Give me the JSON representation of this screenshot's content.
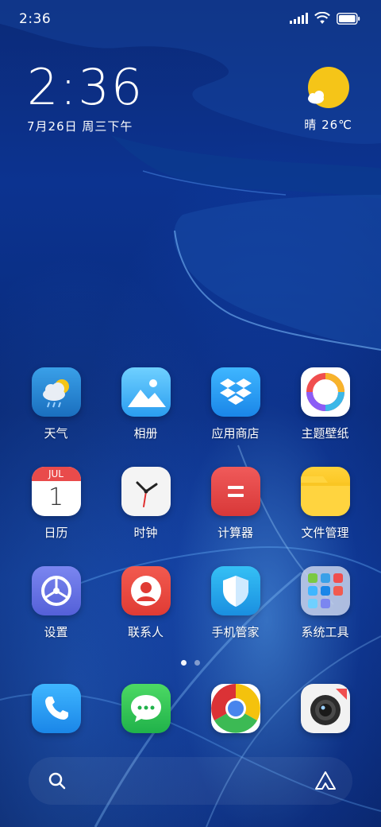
{
  "status_bar": {
    "time": "2:36",
    "icons": [
      "signal-icon",
      "wifi-icon",
      "battery-icon"
    ]
  },
  "clock_widget": {
    "time": "2:36",
    "date": "7月26日 周三下午"
  },
  "weather_widget": {
    "icon": "sunny-partly-cloudy-icon",
    "text": "晴 26℃"
  },
  "apps": [
    {
      "label": "天气",
      "icon": "weather-icon"
    },
    {
      "label": "相册",
      "icon": "gallery-icon"
    },
    {
      "label": "应用商店",
      "icon": "app-store-icon"
    },
    {
      "label": "主题壁纸",
      "icon": "themes-icon"
    },
    {
      "label": "日历",
      "icon": "calendar-icon",
      "badge": "JUL",
      "day": "1"
    },
    {
      "label": "时钟",
      "icon": "clock-icon"
    },
    {
      "label": "计算器",
      "icon": "calculator-icon"
    },
    {
      "label": "文件管理",
      "icon": "file-manager-icon"
    },
    {
      "label": "设置",
      "icon": "settings-icon"
    },
    {
      "label": "联系人",
      "icon": "contacts-icon"
    },
    {
      "label": "手机管家",
      "icon": "security-icon"
    },
    {
      "label": "系统工具",
      "icon": "folder-icon"
    }
  ],
  "page_indicator": {
    "pages": 2,
    "current": 1
  },
  "dock": [
    {
      "icon": "phone-icon"
    },
    {
      "icon": "messages-icon"
    },
    {
      "icon": "browser-icon"
    },
    {
      "icon": "camera-icon"
    }
  ],
  "search_bar": {
    "left_icon": "search-icon",
    "right_icon": "assistant-icon"
  },
  "colors": {
    "wallpaper_base": "#0a2c7c",
    "sun": "#f5c518",
    "calculator": "#e84c4c",
    "folder": "#f9c31a"
  }
}
